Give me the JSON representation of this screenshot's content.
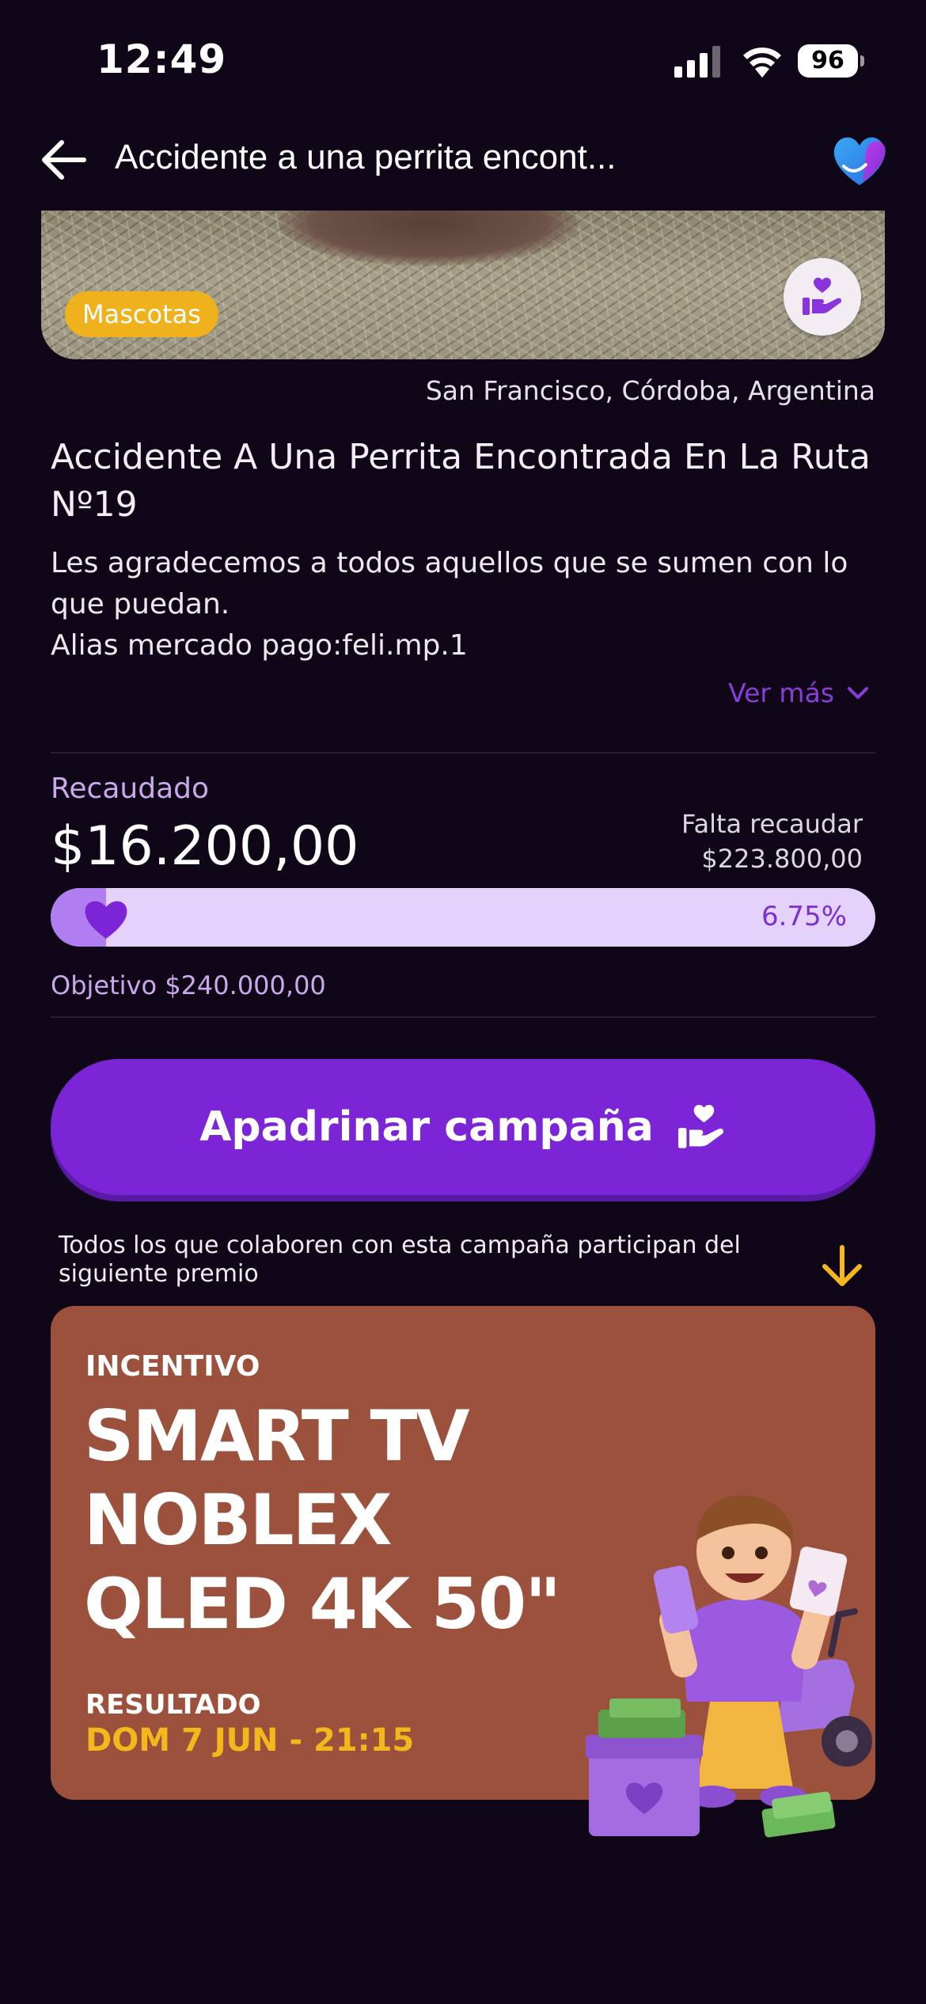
{
  "status_bar": {
    "time": "12:49",
    "battery": "96"
  },
  "header": {
    "title": "Accidente a una perrita encont..."
  },
  "hero": {
    "category": "Mascotas"
  },
  "campaign": {
    "location": "San Francisco, Córdoba, Argentina",
    "title": "Accidente A Una Perrita Encontrada En La Ruta Nº19",
    "description_lines": [
      "Les agradecemos a todos aquellos que se sumen con lo",
      "que puedan.",
      "Alias mercado pago:feli.mp.1"
    ],
    "see_more": "Ver más"
  },
  "funding": {
    "raised_label": "Recaudado",
    "raised_amount": "$16.200,00",
    "remaining_label": "Falta recaudar",
    "remaining_amount": "$223.800,00",
    "progress_percent": 6.75,
    "progress_text": "6.75%",
    "goal_text": "Objetivo $240.000,00"
  },
  "cta": {
    "label": "Apadrinar campaña"
  },
  "prize": {
    "note": "Todos los que colaboren con esta campaña participan del siguiente premio",
    "incentive_label": "INCENTIVO",
    "name": "SMART TV NOBLEX QLED 4K 50\"",
    "result_label": "RESULTADO",
    "result_date": "DOM 7 JUN - 21:15"
  },
  "colors": {
    "background": "#0f0717",
    "accent": "#7b25d6",
    "badge": "#f0b21c",
    "prize_card": "#9c513d",
    "progress_track": "#e5d2fa"
  }
}
